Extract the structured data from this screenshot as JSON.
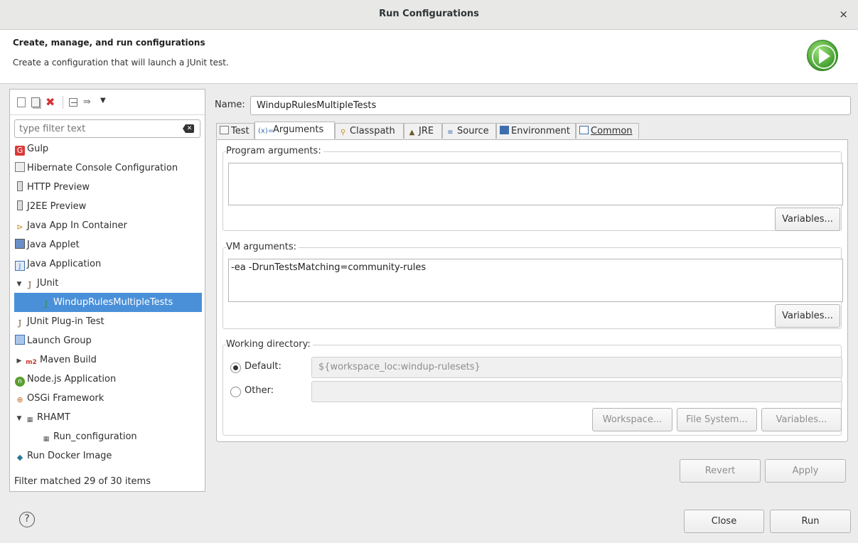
{
  "window": {
    "title": "Run Configurations",
    "close_glyph": "×"
  },
  "header": {
    "title": "Create, manage, and run configurations",
    "description": "Create a configuration that will launch a JUnit test."
  },
  "sidebar": {
    "filter_placeholder": "type filter text",
    "items": [
      {
        "label": "Gulp"
      },
      {
        "label": "Hibernate Console Configuration"
      },
      {
        "label": "HTTP Preview"
      },
      {
        "label": "J2EE Preview"
      },
      {
        "label": "Java App In Container"
      },
      {
        "label": "Java Applet"
      },
      {
        "label": "Java Application"
      },
      {
        "label": "JUnit"
      },
      {
        "label": "WindupRulesMultipleTests"
      },
      {
        "label": "JUnit Plug-in Test"
      },
      {
        "label": "Launch Group"
      },
      {
        "label": "Maven Build"
      },
      {
        "label": "Node.js Application"
      },
      {
        "label": "OSGi Framework"
      },
      {
        "label": "RHAMT"
      },
      {
        "label": "Run_configuration"
      },
      {
        "label": "Run Docker Image"
      }
    ],
    "status": "Filter matched 29 of 30 items"
  },
  "config": {
    "name_label": "Name:",
    "name_value": "WindupRulesMultipleTests",
    "tabs": [
      {
        "label": "Test"
      },
      {
        "label": "Arguments"
      },
      {
        "label": "Classpath"
      },
      {
        "label": "JRE"
      },
      {
        "label": "Source"
      },
      {
        "label": "Environment"
      },
      {
        "label": "Common"
      }
    ],
    "program_args_label": "Program arguments:",
    "program_args_value": "",
    "vm_args_label": "VM arguments:",
    "vm_args_value": "-ea -DrunTestsMatching=community-rules",
    "variables_label": "Variables...",
    "workdir_label": "Working directory:",
    "default_label": "Default:",
    "default_value": "${workspace_loc:windup-rulesets}",
    "other_label": "Other:",
    "other_value": "",
    "workspace_label": "Workspace...",
    "filesystem_label": "File System...",
    "revert_label": "Revert",
    "apply_label": "Apply"
  },
  "footer": {
    "help_glyph": "?",
    "close_label": "Close",
    "run_label": "Run"
  }
}
